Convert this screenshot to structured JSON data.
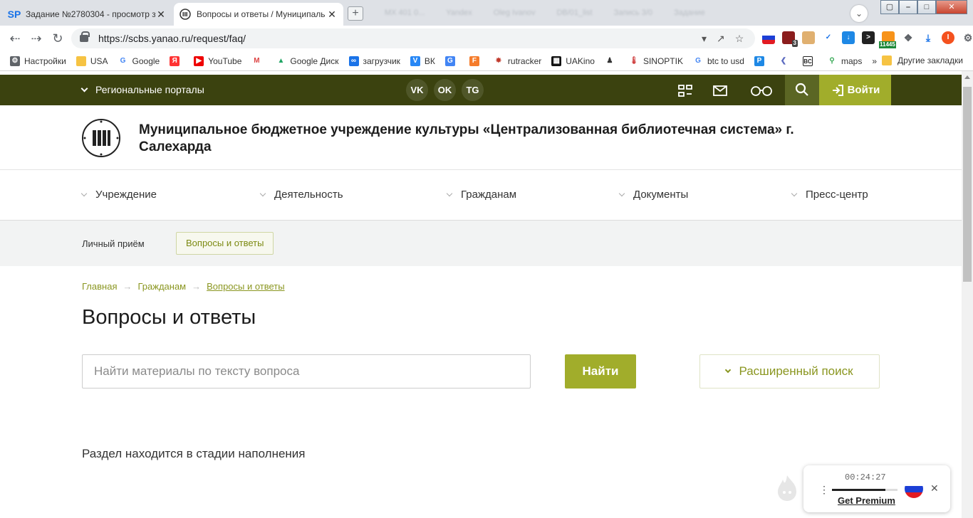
{
  "browser": {
    "tabs": [
      {
        "title": "Задание №2780304 - просмотр з",
        "favicon": "SP",
        "active": false
      },
      {
        "title": "Вопросы и ответы / Муниципаль",
        "favicon": "library-icon",
        "active": true
      }
    ],
    "close_glyph": "✕",
    "new_tab_glyph": "+",
    "ghost_tabs": [
      "MX 401 0...",
      "Yandex",
      "Oleg Ivanov",
      "DB/01_list",
      "Запись 3/0",
      "Задание"
    ],
    "profile_glyph": "⌄",
    "window_controls": [
      "⎯",
      "□",
      "✕"
    ],
    "url": "https://scbs.yanao.ru/request/faq/",
    "extension_badges": {
      "counter": "3",
      "price": "11445",
      "avatar": "I"
    },
    "bookmarks": [
      {
        "label": "Настройки",
        "icon": "gear-icon",
        "color": "#5f6368"
      },
      {
        "label": "USA",
        "icon": "folder-icon",
        "color": "#f6c343"
      },
      {
        "label": "Google",
        "icon": "google-icon",
        "color": "#4285f4"
      },
      {
        "label": "Я",
        "icon": "yandex-icon",
        "color": "#f33"
      },
      {
        "label": "YouTube",
        "icon": "youtube-icon",
        "color": "#e00"
      },
      {
        "label": "",
        "icon": "gmail-icon",
        "color": "#d44"
      },
      {
        "label": "Google Диск",
        "icon": "drive-icon",
        "color": "#1fa463"
      },
      {
        "label": "загрузчик",
        "icon": "infinity-icon",
        "color": "#1a73e8"
      },
      {
        "label": "ВК",
        "icon": "vk-icon",
        "color": "#2787f5"
      },
      {
        "label": "",
        "icon": "translate-icon",
        "color": "#4285f4"
      },
      {
        "label": "",
        "icon": "feedly-icon",
        "color": "#f57c2b"
      },
      {
        "label": "rutracker",
        "icon": "rutracker-icon",
        "color": "#c0392b"
      },
      {
        "label": "UAKino",
        "icon": "uakino-icon",
        "color": "#111"
      },
      {
        "label": "",
        "icon": "figure-icon",
        "color": "#333"
      },
      {
        "label": "SINOPTIK",
        "icon": "thermometer-icon",
        "color": "#c33"
      },
      {
        "label": "btc to usd",
        "icon": "google-icon",
        "color": "#4285f4"
      },
      {
        "label": "",
        "icon": "p-icon",
        "color": "#1e88e5"
      },
      {
        "label": "",
        "icon": "arrow-icon",
        "color": "#5c6bc0"
      },
      {
        "label": "",
        "icon": "bc-icon",
        "color": "#222"
      },
      {
        "label": "maps",
        "icon": "maps-icon",
        "color": "#34a853"
      }
    ],
    "bookmarks_more": "»",
    "other_bookmarks": "Другие закладки"
  },
  "site": {
    "topbar": {
      "portals_label": "Региональные порталы",
      "socials": [
        "VK",
        "OK",
        "TG"
      ],
      "login_label": "Войти"
    },
    "org_name": "Муниципальное бюджетное учреждение культуры «Централизованная библиотечная система» г. Салехарда",
    "main_nav": [
      "Учреждение",
      "Деятельность",
      "Гражданам",
      "Документы",
      "Пресс-центр"
    ],
    "sub_nav": {
      "personal": "Личный приём",
      "faq": "Вопросы и ответы"
    },
    "breadcrumbs": {
      "home": "Главная",
      "citizens": "Гражданам",
      "current": "Вопросы и ответы",
      "separator": "→"
    },
    "page_title": "Вопросы и ответы",
    "search": {
      "placeholder": "Найти материалы по тексту вопроса",
      "button": "Найти",
      "advanced": "Расширенный поиск"
    },
    "empty_message": "Раздел находится в стадии наполнения"
  },
  "vpn_widget": {
    "timer": "00:24:27",
    "menu_glyph": "⋮",
    "progress": 0.82,
    "premium_link": "Get Premium",
    "close_glyph": "✕",
    "flag_colors": [
      "#ffffff",
      "#1c3fd6",
      "#e21b23"
    ]
  }
}
